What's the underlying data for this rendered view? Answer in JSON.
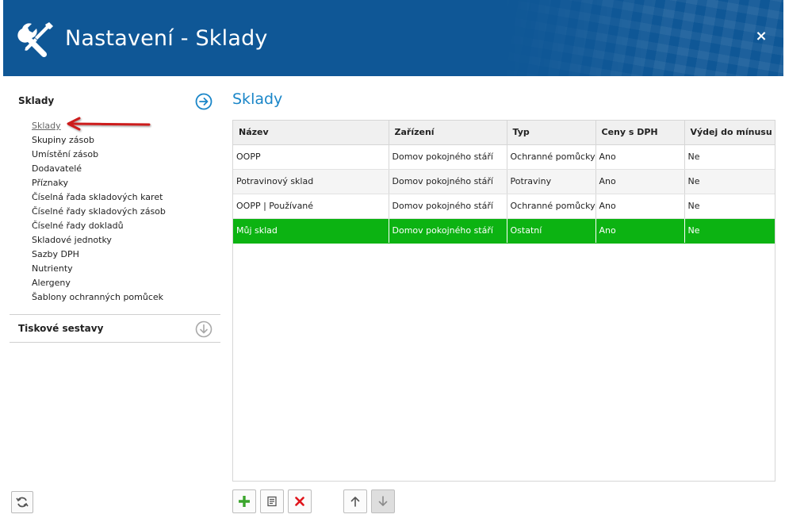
{
  "window": {
    "title": "Nastavení - Sklady",
    "close_label": "×"
  },
  "sidebar": {
    "section1_title": "Sklady",
    "items": [
      {
        "label": "Sklady",
        "active": true
      },
      {
        "label": "Skupiny zásob"
      },
      {
        "label": "Umístění zásob"
      },
      {
        "label": "Dodavatelé"
      },
      {
        "label": "Příznaky"
      },
      {
        "label": "Číselná řada skladových karet"
      },
      {
        "label": "Číselné řady skladových zásob"
      },
      {
        "label": "Číselné řady dokladů"
      },
      {
        "label": "Skladové jednotky"
      },
      {
        "label": "Sazby DPH"
      },
      {
        "label": "Nutrienty"
      },
      {
        "label": "Alergeny"
      },
      {
        "label": "Šablony ochranných pomůcek"
      }
    ],
    "section2_title": "Tiskové sestavy"
  },
  "main": {
    "title": "Sklady",
    "table": {
      "columns": [
        "Název",
        "Zařízení",
        "Typ",
        "Ceny s DPH",
        "Výdej do mínusu"
      ],
      "rows": [
        [
          "OOPP",
          "Domov pokojného stáří",
          "Ochranné pomůcky",
          "Ano",
          "Ne"
        ],
        [
          "Potravinový sklad",
          "Domov pokojného stáří",
          "Potraviny",
          "Ano",
          "Ne"
        ],
        [
          "OOPP | Používané",
          "Domov pokojného stáří",
          "Ochranné pomůcky",
          "Ano",
          "Ne"
        ],
        [
          "Můj sklad",
          "Domov pokojného stáří",
          "Ostatní",
          "Ano",
          "Ne"
        ]
      ],
      "selected_row": 3
    }
  },
  "toolbar": {
    "icons": [
      "add-icon",
      "edit-icon",
      "delete-icon",
      "move-up-icon",
      "move-down-icon"
    ]
  },
  "colors": {
    "header_bg": "#0f5796",
    "accent": "#1a86c8",
    "selected_row": "#0cb312",
    "add": "#3aa52c",
    "delete": "#e0151c",
    "annotation_arrow": "#cc1a1a"
  }
}
